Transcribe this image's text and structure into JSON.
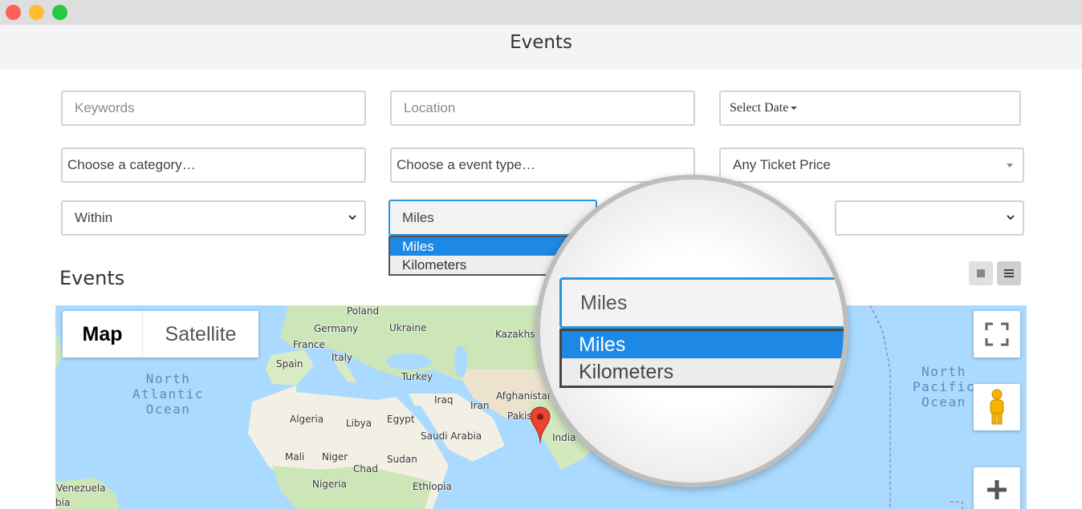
{
  "window": {
    "title": "Events"
  },
  "filters": {
    "keywords_placeholder": "Keywords",
    "location_placeholder": "Location",
    "date_label": "Select Date",
    "category_label": "Choose a category…",
    "event_type_label": "Choose a event type…",
    "ticket_price_label": "Any Ticket Price",
    "within_label": "Within",
    "units_label": "Miles",
    "units_options": [
      "Miles",
      "Kilometers"
    ],
    "units_selected": "Miles"
  },
  "section": {
    "title": "Events"
  },
  "map": {
    "type_buttons": [
      "Map",
      "Satellite"
    ],
    "active_type": "Map",
    "oceans": {
      "north_atlantic": [
        "North",
        "Atlantic",
        "Ocean"
      ],
      "north_pacific": [
        "North",
        "Pacific",
        "Ocean"
      ]
    },
    "labels": [
      "Poland",
      "Germany",
      "Ukraine",
      "Kazakhst",
      "France",
      "Italy",
      "Spain",
      "Turkey",
      "Iraq",
      "Afghanistan",
      "Iran",
      "Algeria",
      "Libya",
      "Egypt",
      "Saudi Arabia",
      "Pakis",
      "India",
      "Mali",
      "Niger",
      "Chad",
      "Sudan",
      "Nigeria",
      "Ethiopia",
      "Venezuela",
      "bia"
    ],
    "controls": [
      "fullscreen-icon",
      "pegman-icon",
      "zoom-in-icon"
    ]
  },
  "colors": {
    "accent": "#2c95de",
    "selected_option": "#1e88e5",
    "land": "#f2efe4",
    "green_land": "#cde6b8",
    "water": "#aadaff",
    "pin": "#e94335"
  }
}
